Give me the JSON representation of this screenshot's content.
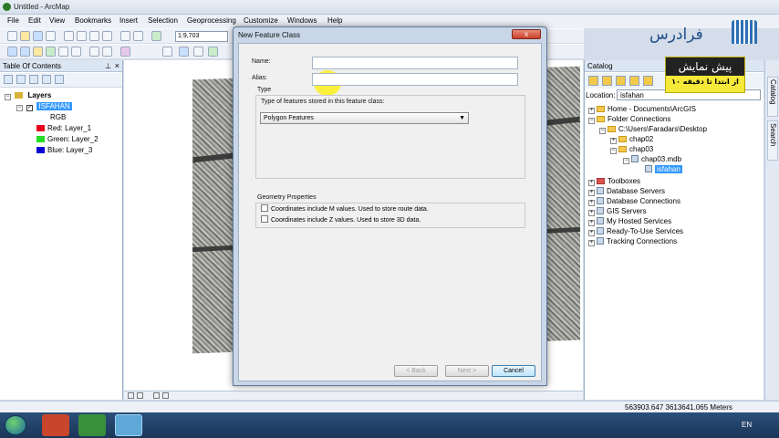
{
  "window": {
    "title": "Untitled - ArcMap"
  },
  "menu": [
    "File",
    "Edit",
    "View",
    "Bookmarks",
    "Insert",
    "Selection",
    "Geoprocessing",
    "Customize",
    "Windows",
    "Help"
  ],
  "toolbar": {
    "scale": "1:9,703"
  },
  "toc": {
    "title": "Table Of Contents",
    "layers_label": "Layers",
    "raster_name": "ISFAHAN",
    "rgb_label": "RGB",
    "bands": [
      {
        "label": "Red:  Layer_1",
        "color": "#e8001c"
      },
      {
        "label": "Green: Layer_2",
        "color": "#22dd22"
      },
      {
        "label": "Blue:  Layer_3",
        "color": "#0c00d6"
      }
    ]
  },
  "dialog": {
    "title": "New Feature Class",
    "close_symbol": "x",
    "name_label": "Name:",
    "name_value": "",
    "alias_label": "Alias:",
    "alias_value": "",
    "type_group": "Type",
    "type_prompt": "Type of features stored in this feature class:",
    "type_selected": "Polygon Features",
    "geometry_group": "Geometry Properties",
    "option_m": "Coordinates include M values. Used to store route data.",
    "option_z": "Coordinates include Z values. Used to store 3D data.",
    "back_label": "< Back",
    "next_label": "Next >",
    "cancel_label": "Cancel"
  },
  "catalog": {
    "title": "Catalog",
    "location_label": "Location:",
    "location_value": "isfahan",
    "tree": [
      "Home - Documents\\ArcGIS",
      "Folder Connections",
      "C:\\Users\\Faradars\\Desktop",
      "chap02",
      "chap03",
      "chap03.mdb",
      "isfahan",
      "Toolboxes",
      "Database Servers",
      "Database Connections",
      "GIS Servers",
      "My Hosted Services",
      "Ready-To-Use Services",
      "Tracking Connections"
    ],
    "side_tabs": [
      "Catalog",
      "Search"
    ]
  },
  "status": {
    "coordinates": "563903.647  3613641.065 Meters"
  },
  "branding": {
    "logo_text": "فرادرس",
    "promo_title": "پیش نمایش",
    "promo_sub": "از ابتدا تا دقیقه ۱۰"
  },
  "taskbar": {
    "language": "EN"
  }
}
